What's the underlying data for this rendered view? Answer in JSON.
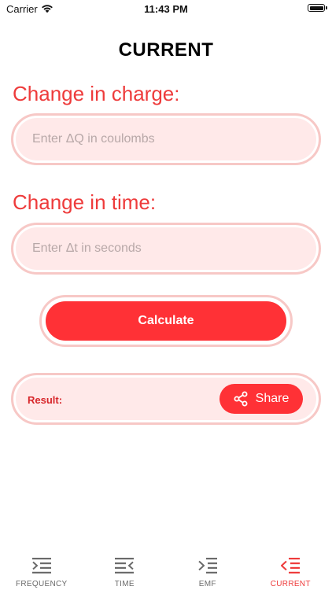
{
  "status_bar": {
    "carrier": "Carrier",
    "time": "11:43 PM"
  },
  "page": {
    "title": "CURRENT"
  },
  "form": {
    "charge_label": "Change in charge:",
    "charge_placeholder": "Enter ΔQ in coulombs",
    "charge_value": "",
    "time_label": "Change in time:",
    "time_placeholder": "Enter Δt in seconds",
    "time_value": "",
    "calculate_label": "Calculate"
  },
  "result": {
    "label": "Result:",
    "value": "",
    "share_label": "Share"
  },
  "tab_bar": {
    "active": "current",
    "items": [
      {
        "label": "FREQUENCY",
        "icon": "indent-right-icon"
      },
      {
        "label": "TIME",
        "icon": "align-left-arrow-icon"
      },
      {
        "label": "EMF",
        "icon": "indent-arrow-icon"
      },
      {
        "label": "CURRENT",
        "icon": "outdent-arrow-icon"
      }
    ]
  },
  "colors": {
    "accent": "#ff3136",
    "label_red": "#ee3b3b",
    "field_bg": "#ffe9e9",
    "field_border": "#f7c8c6",
    "tab_inactive": "#6b6b6b"
  }
}
